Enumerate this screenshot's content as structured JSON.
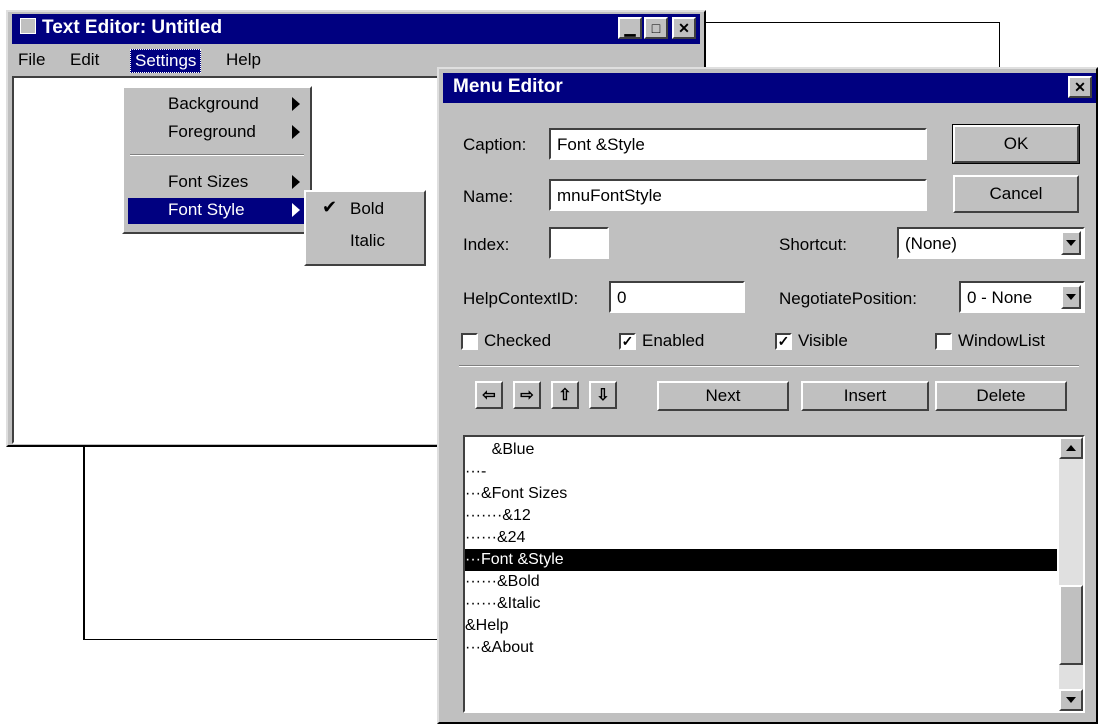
{
  "text_editor": {
    "title": "Text Editor: Untitled",
    "menubar": {
      "file": "File",
      "edit": "Edit",
      "settings": "Settings",
      "help": "Help"
    },
    "settings_menu": {
      "background": "Background",
      "foreground": "Foreground",
      "font_sizes": "Font Sizes",
      "font_style": "Font Style"
    },
    "font_style_menu": {
      "bold": "Bold",
      "italic": "Italic"
    },
    "check_glyph": "✔"
  },
  "menu_editor": {
    "title": "Menu Editor",
    "caption_label": "Caption:",
    "caption_value": "Font &Style",
    "name_label": "Name:",
    "name_value": "mnuFontStyle",
    "index_label": "Index:",
    "index_value": "",
    "shortcut_label": "Shortcut:",
    "shortcut_value": "(None)",
    "helpcontext_label": "HelpContextID:",
    "helpcontext_value": "0",
    "negotiate_label": "NegotiatePosition:",
    "negotiate_value": "0 - None",
    "ok_label": "OK",
    "cancel_label": "Cancel",
    "checkboxes": {
      "checked": {
        "label": "Checked",
        "value": false
      },
      "enabled": {
        "label": "Enabled",
        "value": true
      },
      "visible": {
        "label": "Visible",
        "value": true
      },
      "windowlist": {
        "label": "WindowList",
        "value": false
      }
    },
    "arrows": {
      "left": "⇦",
      "right": "⇨",
      "up": "⇧",
      "down": "⇩"
    },
    "next_label": "Next",
    "insert_label": "Insert",
    "delete_label": "Delete",
    "list_items": [
      "      &Blue",
      "···-",
      "···&Font Sizes",
      "·······&12",
      "······&24",
      "···Font &Style",
      "······&Bold",
      "······&Italic",
      "&Help",
      "···&About"
    ],
    "selected_index": 5
  },
  "colors": {
    "titlebar": "#000080",
    "face": "#c0c0c0"
  }
}
